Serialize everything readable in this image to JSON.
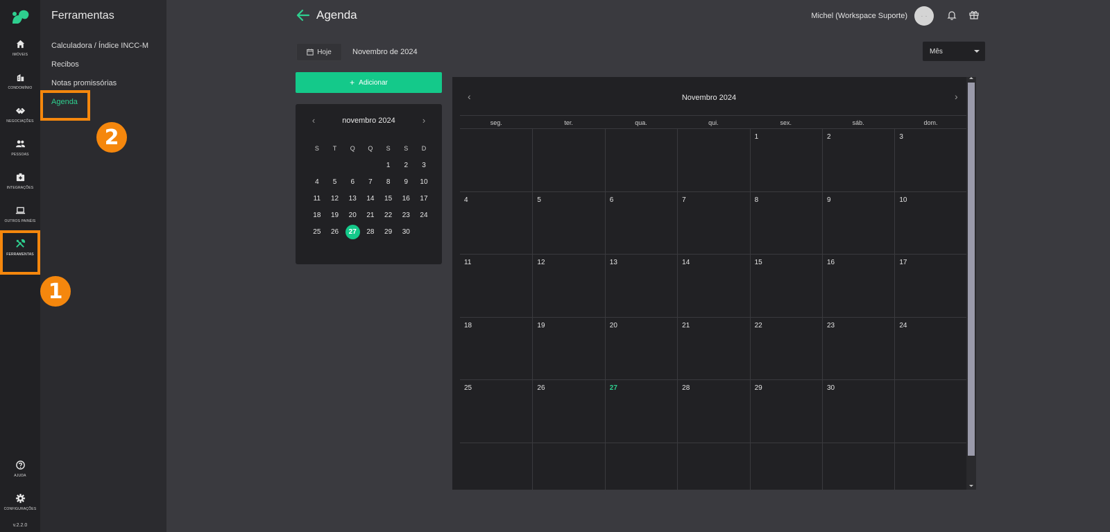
{
  "rail": {
    "items": [
      {
        "id": "imoveis",
        "label": "IMÓVEIS",
        "icon": "home-icon"
      },
      {
        "id": "condominio",
        "label": "CONDOMÍNIO",
        "icon": "building-icon"
      },
      {
        "id": "negociacoes",
        "label": "NEGOCIAÇÕES",
        "icon": "handshake-icon"
      },
      {
        "id": "pessoas",
        "label": "PESSOAS",
        "icon": "people-icon"
      },
      {
        "id": "integracoes",
        "label": "INTEGRAÇÕES",
        "icon": "integration-icon"
      },
      {
        "id": "outros-paineis",
        "label": "OUTROS PAINÉIS",
        "icon": "laptop-icon"
      },
      {
        "id": "ferramentas",
        "label": "FERRAMENTAS",
        "icon": "tools-icon"
      }
    ],
    "help_label": "AJUDA",
    "settings_label": "CONFIGURAÇÕES",
    "version": "v.2.2.0"
  },
  "sidebar": {
    "title": "Ferramentas",
    "items": [
      {
        "label": "Calculadora / Índice INCC-M"
      },
      {
        "label": "Recibos"
      },
      {
        "label": "Notas promissórias"
      },
      {
        "label": "Agenda"
      }
    ]
  },
  "annotations": {
    "badge1": "1",
    "badge2": "2",
    "color": "#f5870d"
  },
  "header": {
    "title": "Agenda",
    "user_name": "Michel (Workspace Suporte)",
    "avatar_text": "· ·"
  },
  "toolbar": {
    "today_label": "Hoje",
    "current_month": "Novembro de 2024",
    "view_selected": "Mês",
    "add_label": "Adicionar"
  },
  "mini_calendar": {
    "title": "novembro 2024",
    "weekdays": [
      "S",
      "T",
      "Q",
      "Q",
      "S",
      "S",
      "D"
    ],
    "leading_blanks": 4,
    "days": 30,
    "today": 27
  },
  "big_calendar": {
    "title": "Novembro 2024",
    "weekdays": [
      "seg.",
      "ter.",
      "qua.",
      "qui.",
      "sex.",
      "sáb.",
      "dom."
    ],
    "leading_blanks": 4,
    "days": 30,
    "today": 27
  },
  "colors": {
    "accent": "#14c98a",
    "background": "#3a3a3f",
    "panel": "#212124"
  }
}
